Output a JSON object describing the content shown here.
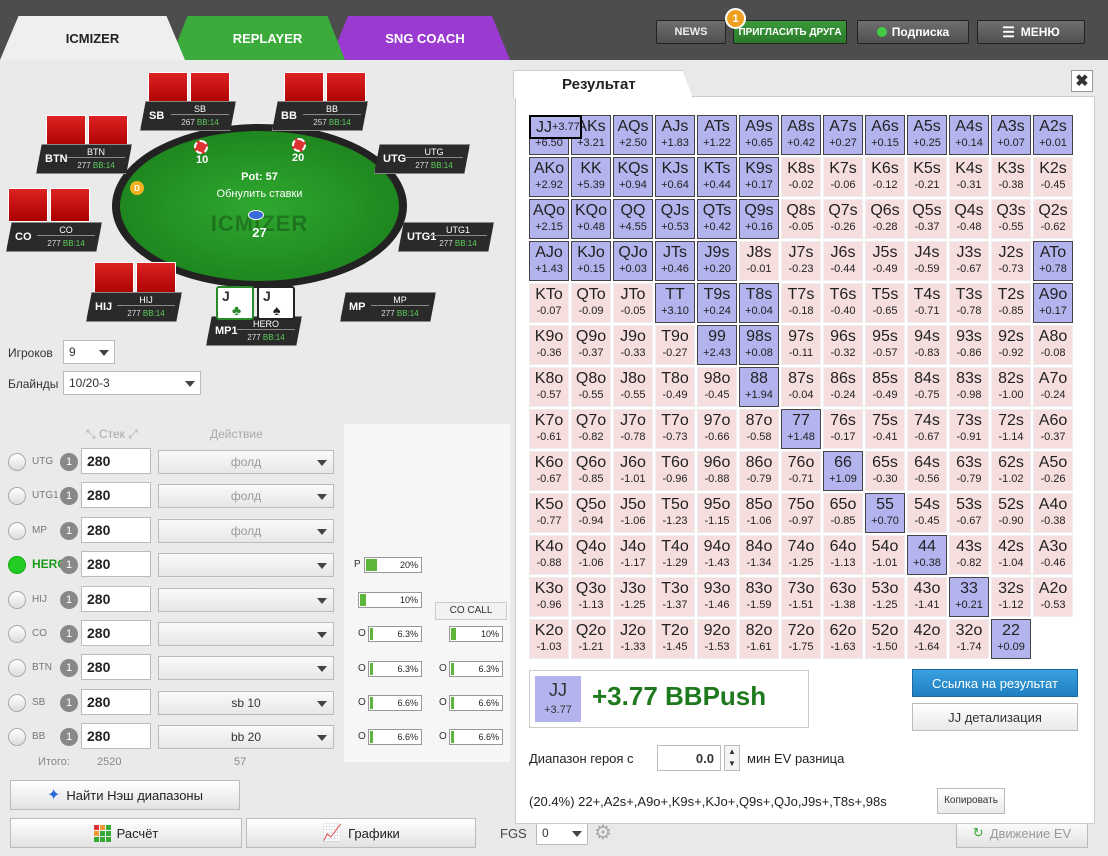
{
  "tabs": [
    "ICMIZER",
    "REPLAYER",
    "SNG COACH"
  ],
  "header": {
    "news": "NEWS",
    "invite_count": "1",
    "invite": "ПРИГЛАСИТЬ ДРУГА",
    "subscription": "Подписка",
    "menu": "МЕНЮ"
  },
  "table": {
    "watermark": "ICMIZER",
    "pot": "Pot: 57",
    "reset": "Обнулить ставки",
    "chips_center": "27",
    "chip_sb": "10",
    "chip_bb": "20",
    "dealer": "D",
    "hero_cards": [
      {
        "rank": "J",
        "suit": "♣"
      },
      {
        "rank": "J",
        "suit": "♠"
      }
    ],
    "seats": [
      {
        "name": "SB",
        "label": "SB",
        "stack": "267",
        "bb": "BB:14"
      },
      {
        "name": "BB",
        "label": "BB",
        "stack": "257",
        "bb": "BB:14"
      },
      {
        "name": "BTN",
        "label": "BTN",
        "stack": "277",
        "bb": "BB:14"
      },
      {
        "name": "UTG",
        "label": "UTG",
        "stack": "277",
        "bb": "BB:14"
      },
      {
        "name": "CO",
        "label": "CO",
        "stack": "277",
        "bb": "BB:14"
      },
      {
        "name": "UTG1",
        "label": "UTG1",
        "stack": "277",
        "bb": "BB:14"
      },
      {
        "name": "HIJ",
        "label": "HIJ",
        "stack": "277",
        "bb": "BB:14"
      },
      {
        "name": "MP",
        "label": "MP",
        "stack": "277",
        "bb": "BB:14"
      },
      {
        "name": "MP1",
        "label": "HERO",
        "stack": "277",
        "bb": "BB:14"
      }
    ]
  },
  "settings": {
    "players_label": "Игроков",
    "players": "9",
    "blinds_label": "Блайнды",
    "blinds": "10/20-3"
  },
  "players_table": {
    "stack_header": "Стек",
    "action_header": "Действие",
    "rows": [
      {
        "pos": "UTG",
        "n": "1",
        "stack": "280",
        "action": "фолд"
      },
      {
        "pos": "UTG1",
        "n": "1",
        "stack": "280",
        "action": "фолд"
      },
      {
        "pos": "MP",
        "n": "1",
        "stack": "280",
        "action": "фолд"
      },
      {
        "pos": "HERO",
        "n": "1",
        "stack": "280",
        "action": ""
      },
      {
        "pos": "HIJ",
        "n": "1",
        "stack": "280",
        "action": ""
      },
      {
        "pos": "CO",
        "n": "1",
        "stack": "280",
        "action": ""
      },
      {
        "pos": "BTN",
        "n": "1",
        "stack": "280",
        "action": ""
      },
      {
        "pos": "SB",
        "n": "1",
        "stack": "280",
        "action": "sb 10"
      },
      {
        "pos": "BB",
        "n": "1",
        "stack": "280",
        "action": "bb 20"
      }
    ],
    "totals_label": "Итого:",
    "total_stack": "2520",
    "total_action": "57"
  },
  "ranges": {
    "push": {
      "prefix": "P",
      "value": "20%",
      "fill": 0.2
    },
    "col1": [
      {
        "prefix": "",
        "value": "10%",
        "fill": 0.1
      },
      {
        "prefix": "O",
        "value": "6.3%",
        "fill": 0.063
      },
      {
        "prefix": "O",
        "value": "6.3%",
        "fill": 0.063
      },
      {
        "prefix": "O",
        "value": "6.6%",
        "fill": 0.066
      },
      {
        "prefix": "O",
        "value": "6.6%",
        "fill": 0.066
      }
    ],
    "co_call_label": "CO CALL",
    "col2": [
      {
        "prefix": "",
        "value": "10%",
        "fill": 0.1
      },
      {
        "prefix": "O",
        "value": "6.3%",
        "fill": 0.063
      },
      {
        "prefix": "O",
        "value": "6.6%",
        "fill": 0.066
      },
      {
        "prefix": "O",
        "value": "6.6%",
        "fill": 0.066
      }
    ]
  },
  "buttons": {
    "nash": "Найти Нэш диапазоны",
    "calc": "Расчёт",
    "graphs": "Графики",
    "fgs_label": "FGS",
    "fgs": "0",
    "ev_move": "Движение EV"
  },
  "result": {
    "title": "Результат",
    "close": "✖",
    "hand": "JJ",
    "hand_ev": "+3.77",
    "ev_text": "+3.77 BBPush",
    "link_btn": "Ссылка на результат",
    "detail_btn": "JJ детализация",
    "hero_range_label": "Диапазон героя с",
    "hero_range_value": "0.0",
    "min_ev_label": "мин EV разница",
    "range_string": "(20.4%) 22+,A2s+,A9o+,K9s+,KJo+,Q9s+,QJo,J9s+,T8s+,98s",
    "copy": "Копировать"
  },
  "matrix": [
    [
      [
        "AA",
        "+6.50",
        1
      ],
      [
        "AKs",
        "+3.21",
        1
      ],
      [
        "AQs",
        "+2.50",
        1
      ],
      [
        "AJs",
        "+1.83",
        1
      ],
      [
        "ATs",
        "+1.22",
        1
      ],
      [
        "A9s",
        "+0.65",
        1
      ],
      [
        "A8s",
        "+0.42",
        1
      ],
      [
        "A7s",
        "+0.27",
        1
      ],
      [
        "A6s",
        "+0.15",
        1
      ],
      [
        "A5s",
        "+0.25",
        1
      ],
      [
        "A4s",
        "+0.14",
        1
      ],
      [
        "A3s",
        "+0.07",
        1
      ],
      [
        "A2s",
        "+0.01",
        1
      ]
    ],
    [
      [
        "AKo",
        "+2.92",
        1
      ],
      [
        "KK",
        "+5.39",
        1
      ],
      [
        "KQs",
        "+0.94",
        1
      ],
      [
        "KJs",
        "+0.64",
        1
      ],
      [
        "KTs",
        "+0.44",
        1
      ],
      [
        "K9s",
        "+0.17",
        1
      ],
      [
        "K8s",
        "-0.02",
        0
      ],
      [
        "K7s",
        "-0.06",
        0
      ],
      [
        "K6s",
        "-0.12",
        0
      ],
      [
        "K5s",
        "-0.21",
        0
      ],
      [
        "K4s",
        "-0.31",
        0
      ],
      [
        "K3s",
        "-0.38",
        0
      ],
      [
        "K2s",
        "-0.45",
        0
      ]
    ],
    [
      [
        "AQo",
        "+2.15",
        1
      ],
      [
        "KQo",
        "+0.48",
        1
      ],
      [
        "QQ",
        "+4.55",
        1
      ],
      [
        "QJs",
        "+0.53",
        1
      ],
      [
        "QTs",
        "+0.42",
        1
      ],
      [
        "Q9s",
        "+0.16",
        1
      ],
      [
        "Q8s",
        "-0.05",
        0
      ],
      [
        "Q7s",
        "-0.26",
        0
      ],
      [
        "Q6s",
        "-0.28",
        0
      ],
      [
        "Q5s",
        "-0.37",
        0
      ],
      [
        "Q4s",
        "-0.48",
        0
      ],
      [
        "Q3s",
        "-0.55",
        0
      ],
      [
        "Q2s",
        "-0.62",
        0
      ]
    ],
    [
      [
        "AJo",
        "+1.43",
        1
      ],
      [
        "KJo",
        "+0.15",
        1
      ],
      [
        "QJo",
        "+0.03",
        1
      ],
      [
        "JJ",
        "+3.77",
        2
      ],
      [
        "JTs",
        "+0.46",
        1
      ],
      [
        "J9s",
        "+0.20",
        1
      ],
      [
        "J8s",
        "-0.01",
        0
      ],
      [
        "J7s",
        "-0.23",
        0
      ],
      [
        "J6s",
        "-0.44",
        0
      ],
      [
        "J5s",
        "-0.49",
        0
      ],
      [
        "J4s",
        "-0.59",
        0
      ],
      [
        "J3s",
        "-0.67",
        0
      ],
      [
        "J2s",
        "-0.73",
        0
      ]
    ],
    [
      [
        "ATo",
        "+0.78",
        1
      ],
      [
        "KTo",
        "-0.07",
        0
      ],
      [
        "QTo",
        "-0.09",
        0
      ],
      [
        "JTo",
        "-0.05",
        0
      ],
      [
        "TT",
        "+3.10",
        1
      ],
      [
        "T9s",
        "+0.24",
        1
      ],
      [
        "T8s",
        "+0.04",
        1
      ],
      [
        "T7s",
        "-0.18",
        0
      ],
      [
        "T6s",
        "-0.40",
        0
      ],
      [
        "T5s",
        "-0.65",
        0
      ],
      [
        "T4s",
        "-0.71",
        0
      ],
      [
        "T3s",
        "-0.78",
        0
      ],
      [
        "T2s",
        "-0.85",
        0
      ]
    ],
    [
      [
        "A9o",
        "+0.17",
        1
      ],
      [
        "K9o",
        "-0.36",
        0
      ],
      [
        "Q9o",
        "-0.37",
        0
      ],
      [
        "J9o",
        "-0.33",
        0
      ],
      [
        "T9o",
        "-0.27",
        0
      ],
      [
        "99",
        "+2.43",
        1
      ],
      [
        "98s",
        "+0.08",
        1
      ],
      [
        "97s",
        "-0.11",
        0
      ],
      [
        "96s",
        "-0.32",
        0
      ],
      [
        "95s",
        "-0.57",
        0
      ],
      [
        "94s",
        "-0.83",
        0
      ],
      [
        "93s",
        "-0.86",
        0
      ],
      [
        "92s",
        "-0.92",
        0
      ]
    ],
    [
      [
        "A8o",
        "-0.08",
        0
      ],
      [
        "K8o",
        "-0.57",
        0
      ],
      [
        "Q8o",
        "-0.55",
        0
      ],
      [
        "J8o",
        "-0.55",
        0
      ],
      [
        "T8o",
        "-0.49",
        0
      ],
      [
        "98o",
        "-0.45",
        0
      ],
      [
        "88",
        "+1.94",
        1
      ],
      [
        "87s",
        "-0.04",
        0
      ],
      [
        "86s",
        "-0.24",
        0
      ],
      [
        "85s",
        "-0.49",
        0
      ],
      [
        "84s",
        "-0.75",
        0
      ],
      [
        "83s",
        "-0.98",
        0
      ],
      [
        "82s",
        "-1.00",
        0
      ]
    ],
    [
      [
        "A7o",
        "-0.24",
        0
      ],
      [
        "K7o",
        "-0.61",
        0
      ],
      [
        "Q7o",
        "-0.82",
        0
      ],
      [
        "J7o",
        "-0.78",
        0
      ],
      [
        "T7o",
        "-0.73",
        0
      ],
      [
        "97o",
        "-0.66",
        0
      ],
      [
        "87o",
        "-0.58",
        0
      ],
      [
        "77",
        "+1.48",
        1
      ],
      [
        "76s",
        "-0.17",
        0
      ],
      [
        "75s",
        "-0.41",
        0
      ],
      [
        "74s",
        "-0.67",
        0
      ],
      [
        "73s",
        "-0.91",
        0
      ],
      [
        "72s",
        "-1.14",
        0
      ]
    ],
    [
      [
        "A6o",
        "-0.37",
        0
      ],
      [
        "K6o",
        "-0.67",
        0
      ],
      [
        "Q6o",
        "-0.85",
        0
      ],
      [
        "J6o",
        "-1.01",
        0
      ],
      [
        "T6o",
        "-0.96",
        0
      ],
      [
        "96o",
        "-0.88",
        0
      ],
      [
        "86o",
        "-0.79",
        0
      ],
      [
        "76o",
        "-0.71",
        0
      ],
      [
        "66",
        "+1.09",
        1
      ],
      [
        "65s",
        "-0.30",
        0
      ],
      [
        "64s",
        "-0.56",
        0
      ],
      [
        "63s",
        "-0.79",
        0
      ],
      [
        "62s",
        "-1.02",
        0
      ]
    ],
    [
      [
        "A5o",
        "-0.26",
        0
      ],
      [
        "K5o",
        "-0.77",
        0
      ],
      [
        "Q5o",
        "-0.94",
        0
      ],
      [
        "J5o",
        "-1.06",
        0
      ],
      [
        "T5o",
        "-1.23",
        0
      ],
      [
        "95o",
        "-1.15",
        0
      ],
      [
        "85o",
        "-1.06",
        0
      ],
      [
        "75o",
        "-0.97",
        0
      ],
      [
        "65o",
        "-0.85",
        0
      ],
      [
        "55",
        "+0.70",
        1
      ],
      [
        "54s",
        "-0.45",
        0
      ],
      [
        "53s",
        "-0.67",
        0
      ],
      [
        "52s",
        "-0.90",
        0
      ]
    ],
    [
      [
        "A4o",
        "-0.38",
        0
      ],
      [
        "K4o",
        "-0.88",
        0
      ],
      [
        "Q4o",
        "-1.06",
        0
      ],
      [
        "J4o",
        "-1.17",
        0
      ],
      [
        "T4o",
        "-1.29",
        0
      ],
      [
        "94o",
        "-1.43",
        0
      ],
      [
        "84o",
        "-1.34",
        0
      ],
      [
        "74o",
        "-1.25",
        0
      ],
      [
        "64o",
        "-1.13",
        0
      ],
      [
        "54o",
        "-1.01",
        0
      ],
      [
        "44",
        "+0.38",
        1
      ],
      [
        "43s",
        "-0.82",
        0
      ],
      [
        "42s",
        "-1.04",
        0
      ]
    ],
    [
      [
        "A3o",
        "-0.46",
        0
      ],
      [
        "K3o",
        "-0.96",
        0
      ],
      [
        "Q3o",
        "-1.13",
        0
      ],
      [
        "J3o",
        "-1.25",
        0
      ],
      [
        "T3o",
        "-1.37",
        0
      ],
      [
        "93o",
        "-1.46",
        0
      ],
      [
        "83o",
        "-1.59",
        0
      ],
      [
        "73o",
        "-1.51",
        0
      ],
      [
        "63o",
        "-1.38",
        0
      ],
      [
        "53o",
        "-1.25",
        0
      ],
      [
        "43o",
        "-1.41",
        0
      ],
      [
        "33",
        "+0.21",
        1
      ],
      [
        "32s",
        "-1.12",
        0
      ]
    ],
    [
      [
        "A2o",
        "-0.53",
        0
      ],
      [
        "K2o",
        "-1.03",
        0
      ],
      [
        "Q2o",
        "-1.21",
        0
      ],
      [
        "J2o",
        "-1.33",
        0
      ],
      [
        "T2o",
        "-1.45",
        0
      ],
      [
        "92o",
        "-1.53",
        0
      ],
      [
        "82o",
        "-1.61",
        0
      ],
      [
        "72o",
        "-1.75",
        0
      ],
      [
        "62o",
        "-1.63",
        0
      ],
      [
        "52o",
        "-1.50",
        0
      ],
      [
        "42o",
        "-1.64",
        0
      ],
      [
        "32o",
        "-1.74",
        0
      ],
      [
        "22",
        "+0.09",
        1
      ]
    ]
  ],
  "colors": {
    "push_cell": "#b3b3ee",
    "fold_cell": "#f6dede",
    "ev_green": "#1f7a1f",
    "accent_blue": "#1e7fc0"
  }
}
